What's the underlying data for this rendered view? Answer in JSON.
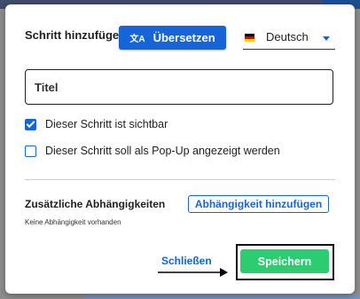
{
  "dialog": {
    "title": "Schritt hinzufügen",
    "translate_button": {
      "icon": "translate-icon",
      "icon_glyph": "文A",
      "label": "Übersetzen"
    },
    "language_select": {
      "flag": "germany-flag",
      "value": "Deutsch"
    },
    "title_input": {
      "placeholder": "Titel",
      "value": ""
    },
    "checkboxes": [
      {
        "label": "Dieser Schritt ist sichtbar",
        "checked": true
      },
      {
        "label": "Dieser Schritt soll als Pop-Up angezeigt werden",
        "checked": false
      }
    ],
    "dependencies": {
      "title": "Zusätzliche Abhängigkeiten",
      "empty_text": "Keine Abhängigkeit vorhanden",
      "add_button": "Abhängigkeit hinzufügen"
    },
    "footer": {
      "close_label": "Schließen",
      "save_label": "Speichern"
    }
  },
  "colors": {
    "primary": "#1565d8",
    "save": "#2ecc71",
    "backdrop": "#8e8e8e"
  }
}
